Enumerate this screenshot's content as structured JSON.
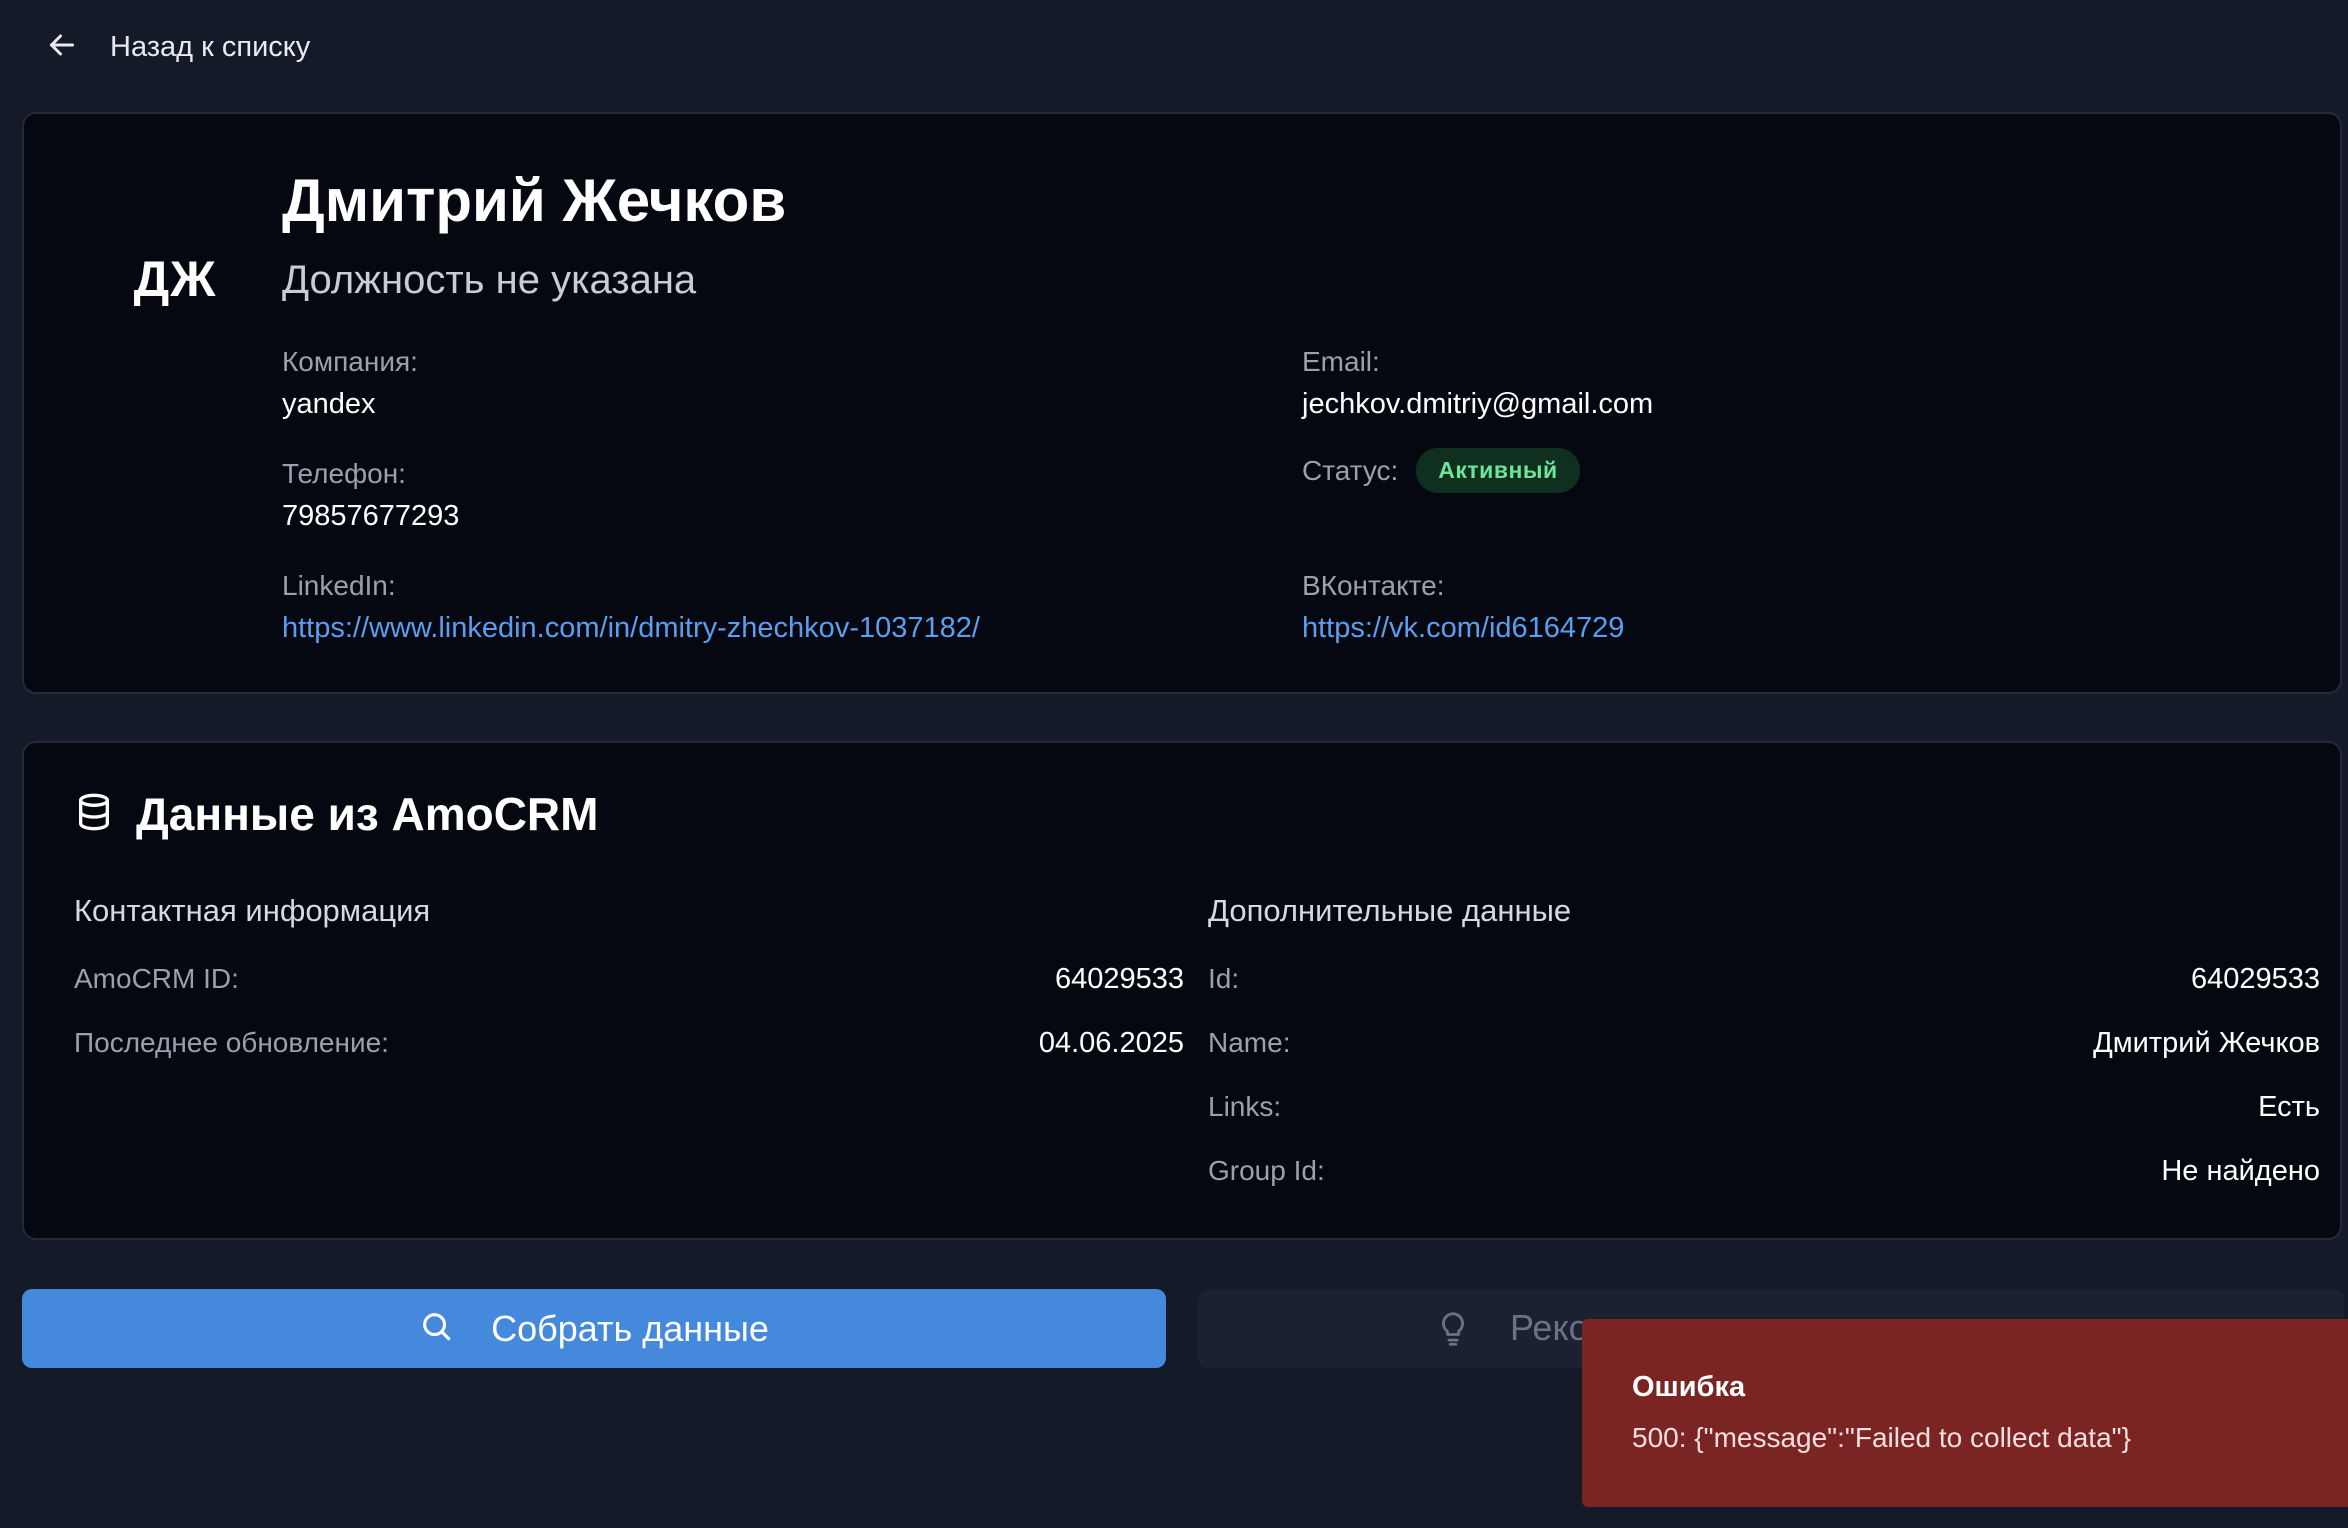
{
  "nav": {
    "back_label": "Назад к списку"
  },
  "profile": {
    "initials": "ДЖ",
    "name": "Дмитрий Жечков",
    "position": "Должность не указана",
    "company_label": "Компания:",
    "company": "yandex",
    "phone_label": "Телефон:",
    "phone": "79857677293",
    "linkedin_label": "LinkedIn:",
    "linkedin": "https://www.linkedin.com/in/dmitry-zhechkov-1037182/",
    "email_label": "Email:",
    "email": "jechkov.dmitriy@gmail.com",
    "status_label": "Статус:",
    "status": "Активный",
    "vk_label": "ВКонтакте:",
    "vk": "https://vk.com/id6164729"
  },
  "crm": {
    "title": "Данные из AmoCRM",
    "contact": {
      "heading": "Контактная информация",
      "rows": [
        {
          "key": "AmoCRM ID:",
          "value": "64029533"
        },
        {
          "key": "Последнее обновление:",
          "value": "04.06.2025"
        }
      ]
    },
    "extra": {
      "heading": "Дополнительные данные",
      "rows": [
        {
          "key": "Id:",
          "value": "64029533"
        },
        {
          "key": "Name:",
          "value": "Дмитрий Жечков"
        },
        {
          "key": "Links:",
          "value": "Есть"
        },
        {
          "key": "Group Id:",
          "value": "Не найдено"
        }
      ]
    }
  },
  "actions": {
    "collect_label": "Собрать данные",
    "recommend_label_visible": "Реко"
  },
  "toast": {
    "title": "Ошибка",
    "message": "500: {\"message\":\"Failed to collect data\"}"
  },
  "colors": {
    "background": "#141a28",
    "card": "#050810",
    "primary": "#4589dc",
    "link": "#5b9ef0",
    "status_active": "#6ee39a",
    "error": "#7a2524"
  }
}
